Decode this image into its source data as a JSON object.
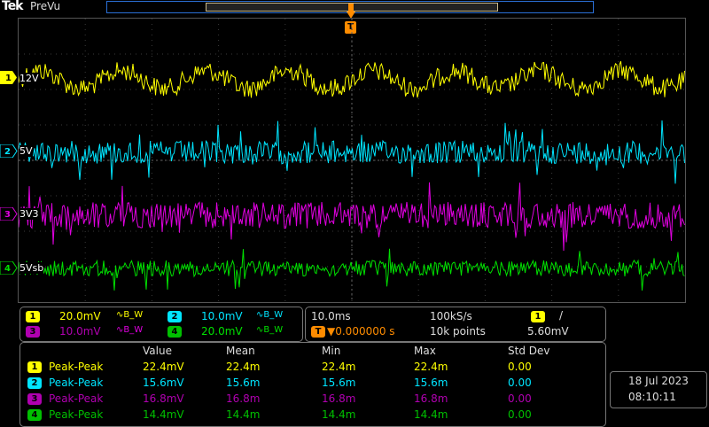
{
  "header": {
    "logo": "Tek",
    "mode": "PreVu"
  },
  "trigger_marker": "T",
  "colors": {
    "ch1": "#ffff00",
    "ch2": "#00e5ff",
    "ch3": "#e000e0",
    "ch4": "#00e000",
    "trigger": "#ff8c00"
  },
  "channels": [
    {
      "num": "1",
      "label": "12V",
      "scale": "20.0mV",
      "bw": "∿B_W"
    },
    {
      "num": "2",
      "label": "5V",
      "scale": "10.0mV",
      "bw": "∿B_W"
    },
    {
      "num": "3",
      "label": "3V3",
      "scale": "10.0mV",
      "bw": "∿B_W"
    },
    {
      "num": "4",
      "label": "5Vsb",
      "scale": "20.0mV",
      "bw": "∿B_W"
    }
  ],
  "horizontal": {
    "timebase": "10.0ms",
    "sample_rate": "100kS/s",
    "trigger_pos": "▼0.000000 s",
    "points": "10k points",
    "trigger_channel": "1",
    "trigger_slope": "/",
    "trigger_level": "5.60mV"
  },
  "measurements": {
    "columns": [
      "Value",
      "Mean",
      "Min",
      "Max",
      "Std Dev"
    ],
    "rows": [
      {
        "ch": "1",
        "type": "Peak-Peak",
        "value": "22.4mV",
        "mean": "22.4m",
        "min": "22.4m",
        "max": "22.4m",
        "std": "0.00"
      },
      {
        "ch": "2",
        "type": "Peak-Peak",
        "value": "15.6mV",
        "mean": "15.6m",
        "min": "15.6m",
        "max": "15.6m",
        "std": "0.00"
      },
      {
        "ch": "3",
        "type": "Peak-Peak",
        "value": "16.8mV",
        "mean": "16.8m",
        "min": "16.8m",
        "max": "16.8m",
        "std": "0.00"
      },
      {
        "ch": "4",
        "type": "Peak-Peak",
        "value": "14.4mV",
        "mean": "14.4m",
        "min": "14.4m",
        "max": "14.4m",
        "std": "0.00"
      }
    ]
  },
  "clock": {
    "date": "18 Jul  2023",
    "time": "08:10:11"
  }
}
